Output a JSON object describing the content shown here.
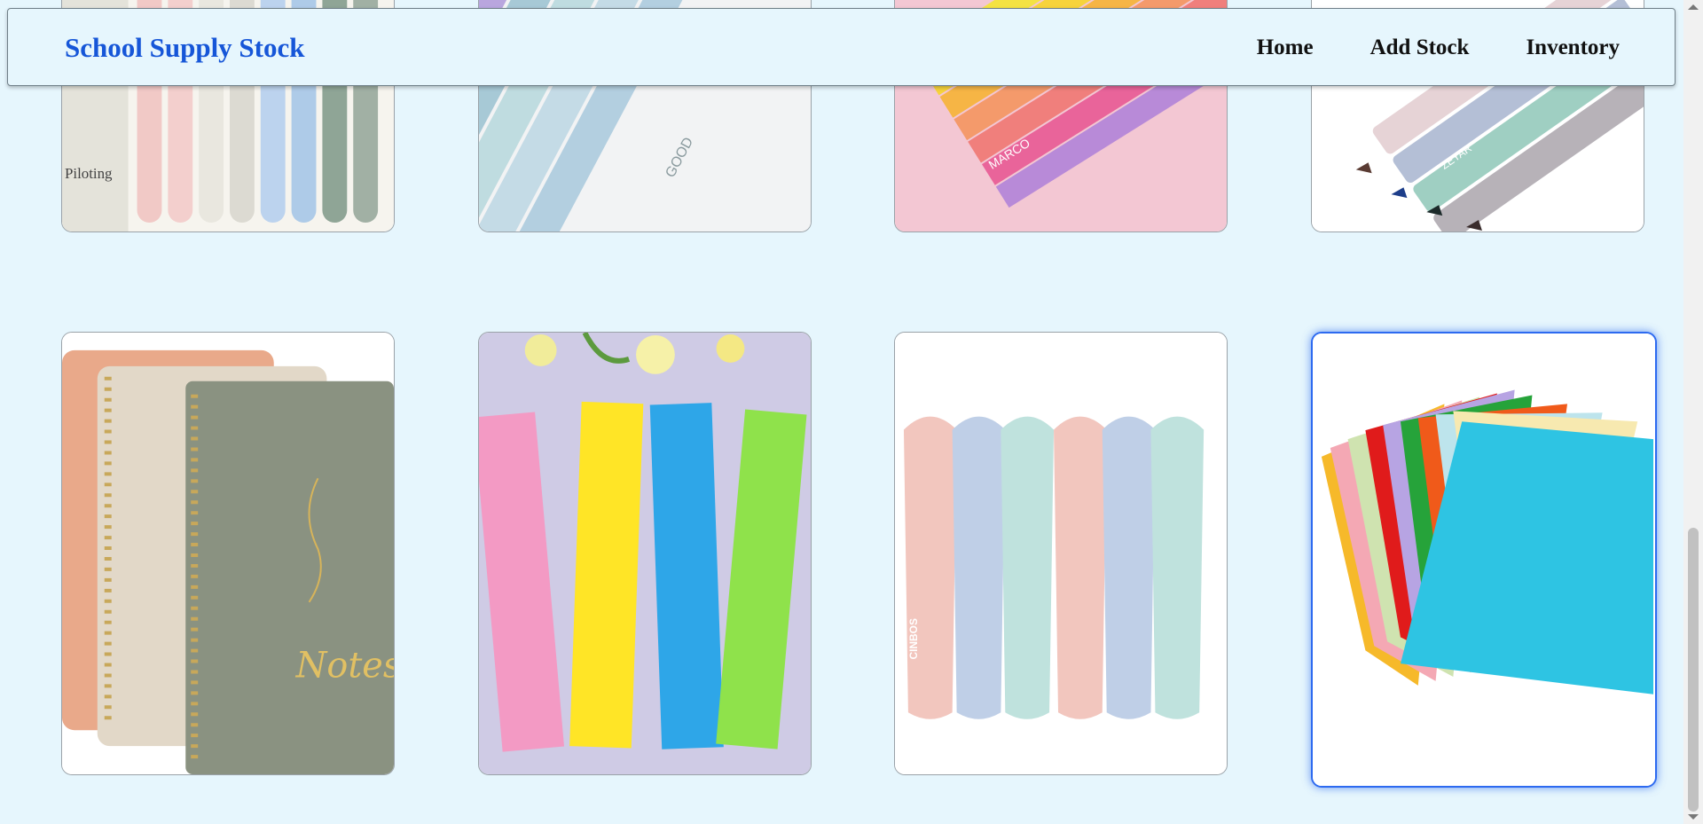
{
  "header": {
    "brand": "School Supply Stock",
    "nav": [
      "Home",
      "Add Stock",
      "Inventory"
    ]
  },
  "cards_row1": [
    {
      "item": "pens-image",
      "text": "Piloting"
    },
    {
      "item": "pastel-pencils-image",
      "text": "GOOD"
    },
    {
      "item": "colored-pencils-image",
      "text": "MARCO"
    },
    {
      "item": "highlighters-image",
      "text": "ZEYAR"
    }
  ],
  "cards_row2": [
    {
      "item": "notebooks-image",
      "text": "Notes"
    },
    {
      "item": "rulers-image",
      "text": ""
    },
    {
      "item": "correction-tape-image",
      "text": "CINBOS"
    },
    {
      "item": "colored-paper-image",
      "text": ""
    }
  ],
  "colors": {
    "background": "#e6f6fd",
    "brand": "#1656d8",
    "selected_border": "#2d6af0"
  }
}
